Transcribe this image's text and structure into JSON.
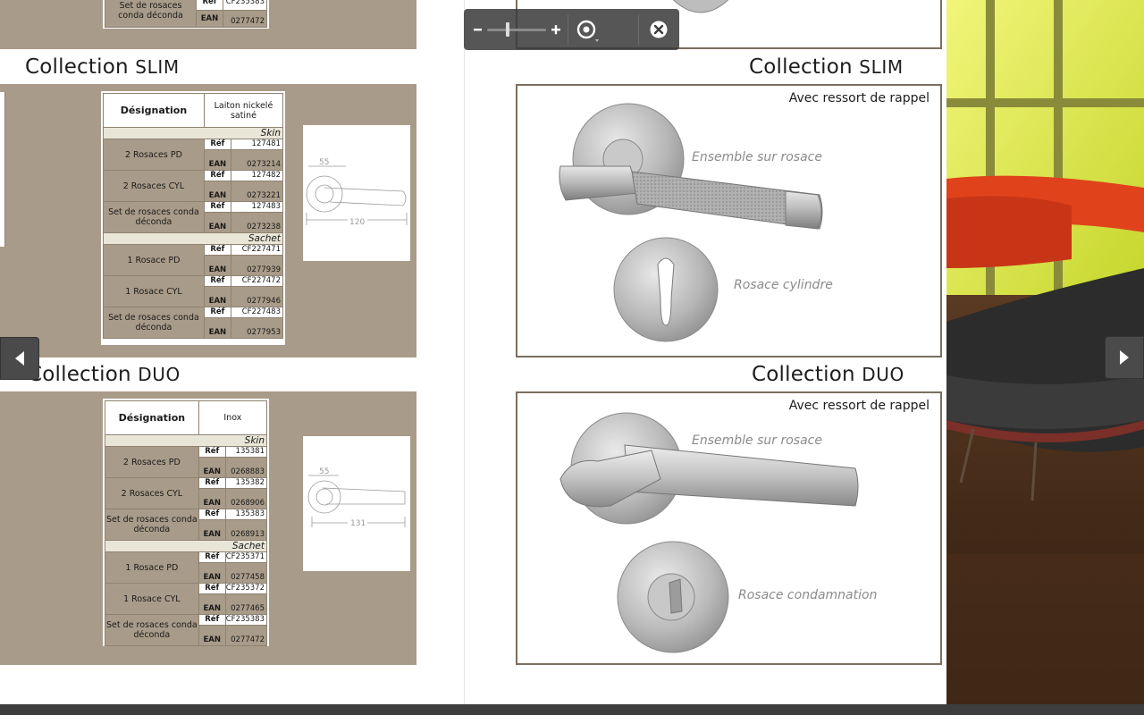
{
  "viewer": {
    "zoom_out_label": "−",
    "zoom_in_label": "+",
    "zoom_level": 0.35
  },
  "left_page": {
    "top_fragment": {
      "desig": "Set de rosaces conda déconda",
      "ref_label": "Réf",
      "ref_value": "CF235383",
      "ean_label": "EAN",
      "ean_value": "0277472"
    },
    "slim": {
      "title_word": "Collection",
      "title_caps": "SLIM",
      "table": {
        "header_designation": "Désignation",
        "header_material": "Laiton nickelé satiné",
        "sections": [
          {
            "name": "Skin",
            "rows": [
              {
                "desig": "2 Rosaces PD",
                "ref": "127481",
                "ean": "0273214"
              },
              {
                "desig": "2 Rosaces CYL",
                "ref": "127482",
                "ean": "0273221"
              },
              {
                "desig": "Set de rosaces conda déconda",
                "ref": "127483",
                "ean": "0273238"
              }
            ]
          },
          {
            "name": "Sachet",
            "rows": [
              {
                "desig": "1 Rosace PD",
                "ref": "CF227471",
                "ean": "0277939"
              },
              {
                "desig": "1 Rosace CYL",
                "ref": "CF227472",
                "ean": "0277946"
              },
              {
                "desig": "Set de rosaces conda déconda",
                "ref": "CF227483",
                "ean": "0277953"
              }
            ]
          }
        ]
      },
      "drawing": {
        "dim_top": "55",
        "dim_bottom": "120"
      }
    },
    "duo": {
      "title_word": "Collection",
      "title_caps": "DUO",
      "table": {
        "header_designation": "Désignation",
        "header_material": "Inox",
        "sections": [
          {
            "name": "Skin",
            "rows": [
              {
                "desig": "2 Rosaces PD",
                "ref": "135381",
                "ean": "0268883"
              },
              {
                "desig": "2 Rosaces CYL",
                "ref": "135382",
                "ean": "0268906"
              },
              {
                "desig": "Set de rosaces conda déconda",
                "ref": "135383",
                "ean": "0268913"
              }
            ]
          },
          {
            "name": "Sachet",
            "rows": [
              {
                "desig": "1 Rosace PD",
                "ref": "CF235371",
                "ean": "0277458"
              },
              {
                "desig": "1 Rosace CYL",
                "ref": "CF235372",
                "ean": "0277465"
              },
              {
                "desig": "Set de rosaces conda déconda",
                "ref": "CF235383",
                "ean": "0277472"
              }
            ]
          }
        ]
      },
      "drawing": {
        "dim_top": "55",
        "dim_bottom": "131"
      }
    },
    "ref_label": "Réf",
    "ean_label": "EAN"
  },
  "right_page": {
    "slim": {
      "title_word": "Collection",
      "title_caps": "SLIM",
      "caption": "Avec ressort de rappel",
      "label_rose": "Ensemble sur rosace",
      "label_cyl": "Rosace cylindre"
    },
    "duo": {
      "title_word": "Collection",
      "title_caps": "DUO",
      "caption": "Avec ressort de rappel",
      "label_rose": "Ensemble sur rosace",
      "label_cond": "Rosace condamnation"
    }
  },
  "colors": {
    "taupe": "#a99b89",
    "frame": "#7b6f5f",
    "toolbar": "#3a3a3a"
  },
  "icons": [
    "zoom-out-icon",
    "zoom-in-icon",
    "reset-zoom-icon",
    "close-icon",
    "prev-page-icon",
    "next-page-icon"
  ]
}
